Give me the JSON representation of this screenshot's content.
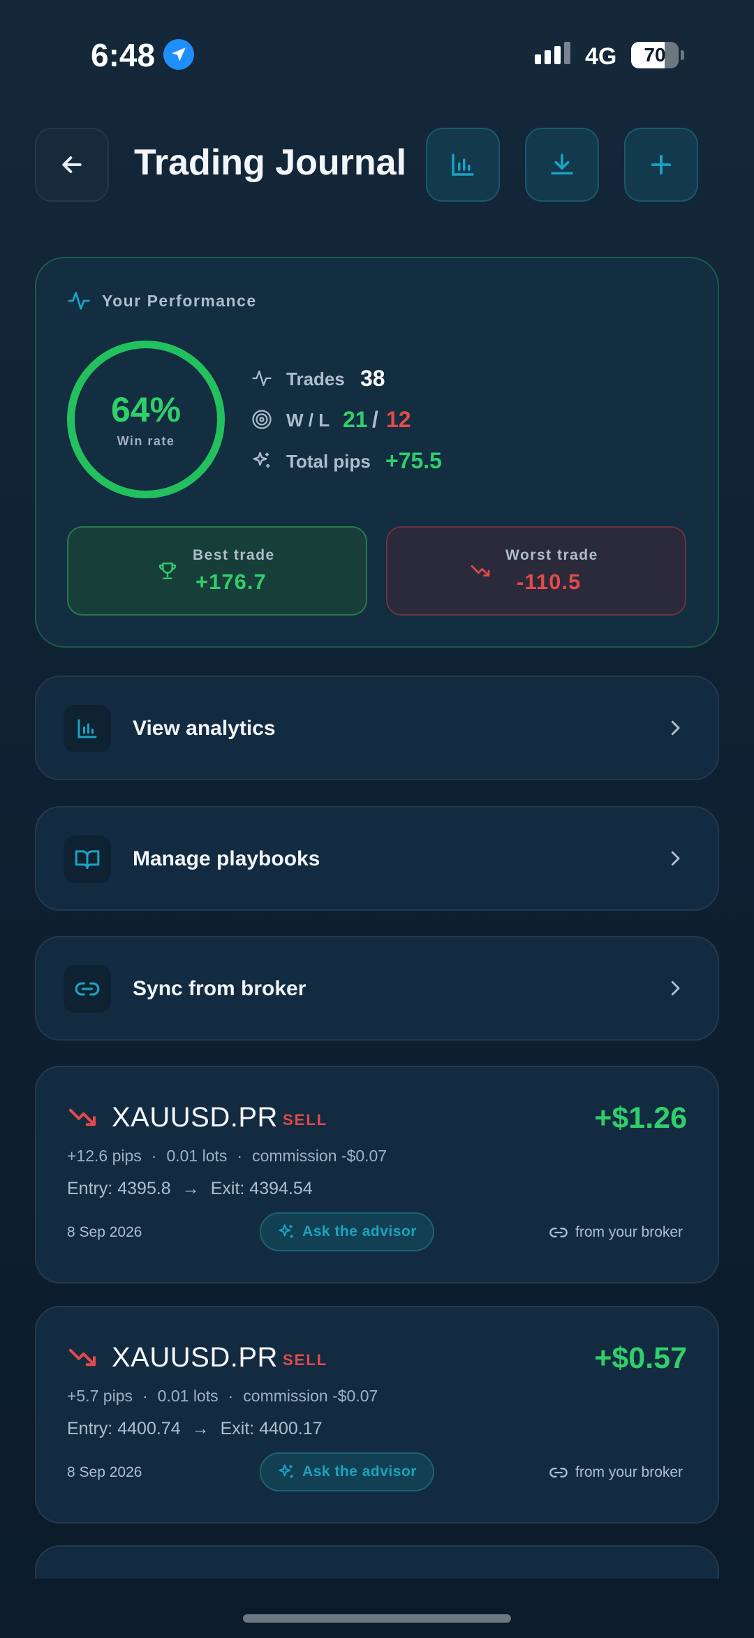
{
  "status_bar": {
    "time": "6:48",
    "network": "4G",
    "battery": "70",
    "battery_level": 0.7
  },
  "header": {
    "title": "Trading Journal",
    "icons": [
      "back-arrow-icon",
      "bar-chart-icon",
      "download-icon",
      "plus-icon"
    ]
  },
  "performance": {
    "title": "Your Performance",
    "win_rate": "64%",
    "win_rate_value": 64,
    "win_rate_label": "Win rate",
    "trades_label": "Trades",
    "trades": "38",
    "wl_label": "W / L",
    "wins": "21",
    "wl_sep": "/",
    "losses": "12",
    "pips_label": "Total pips",
    "pips": "+75.5",
    "best_label": "Best trade",
    "best_value": "+176.7",
    "worst_label": "Worst trade",
    "worst_value": "-110.5"
  },
  "menu": [
    {
      "label": "View analytics",
      "icon": "bar-chart-icon"
    },
    {
      "label": "Manage playbooks",
      "icon": "book-icon"
    },
    {
      "label": "Sync from broker",
      "icon": "link-icon"
    }
  ],
  "trades": [
    {
      "symbol": "XAUUSD.PR",
      "side": "SELL",
      "pnl": "+$1.26",
      "pips": "+12.6 pips",
      "lots": "0.01 lots",
      "commission": "commission -$0.07",
      "entry": "Entry: 4395.8",
      "exit": "Exit: 4394.54",
      "date": "8 Sep 2026",
      "ask": "Ask the advisor",
      "source": "from your broker"
    },
    {
      "symbol": "XAUUSD.PR",
      "side": "SELL",
      "pnl": "+$0.57",
      "pips": "+5.7 pips",
      "lots": "0.01 lots",
      "commission": "commission -$0.07",
      "entry": "Entry: 4400.74",
      "exit": "Exit: 4400.17",
      "date": "8 Sep 2026",
      "ask": "Ask the advisor",
      "source": "from your broker"
    }
  ],
  "separators": {
    "dot": "·",
    "arrow": "→"
  },
  "colors": {
    "accent": "#1aa3c4",
    "positive": "#2fcf6a",
    "negative": "#e24b4b",
    "background": "#0f2233"
  }
}
